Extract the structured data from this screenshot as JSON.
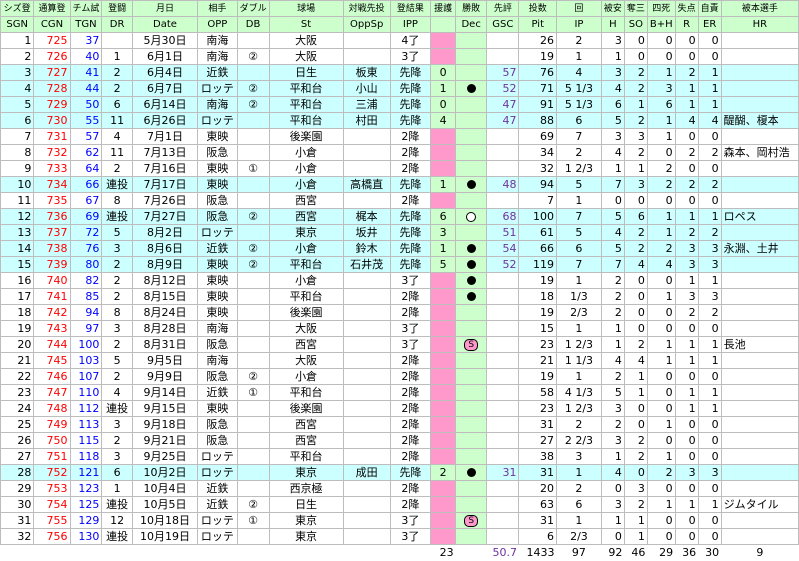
{
  "headers_jp": [
    "シズ登",
    "通算登",
    "チム試",
    "登闘",
    "月日",
    "相手",
    "ダブル",
    "球場",
    "対戦先投",
    "登結果",
    "援護",
    "勝敗",
    "先評",
    "投数",
    "回",
    "被安",
    "奪三",
    "四死",
    "失点",
    "自責",
    "被本選手"
  ],
  "headers_en": [
    "SGN",
    "CGN",
    "TGN",
    "DR",
    "Date",
    "OPP",
    "DB",
    "St",
    "OppSp",
    "IPP",
    "",
    "Dec",
    "GSC",
    "Pit",
    "IP",
    "H",
    "SO",
    "B+H",
    "R",
    "ER",
    "HR"
  ],
  "rows": [
    {
      "sgn": "1",
      "cgn": "725",
      "tgn": "37",
      "dr": "",
      "date": "5月30日",
      "opp": "南海",
      "db": "",
      "st": "大阪",
      "oppsp": "",
      "ipp": "4了",
      "sup": "",
      "dec": "",
      "gsc": "",
      "pit": "26",
      "ip": "2",
      "h": "3",
      "so": "0",
      "bh": "0",
      "r": "0",
      "er": "0",
      "hr": ""
    },
    {
      "sgn": "2",
      "cgn": "726",
      "tgn": "40",
      "dr": "1",
      "date": "6月1日",
      "opp": "南海",
      "db": "②",
      "st": "大阪",
      "oppsp": "",
      "ipp": "3了",
      "sup": "",
      "dec": "",
      "gsc": "",
      "pit": "19",
      "ip": "1",
      "h": "1",
      "so": "0",
      "bh": "0",
      "r": "0",
      "er": "0",
      "hr": ""
    },
    {
      "sgn": "3",
      "cgn": "727",
      "tgn": "41",
      "dr": "2",
      "date": "6月4日",
      "opp": "近鉄",
      "db": "",
      "st": "日生",
      "oppsp": "板東",
      "ipp": "先降",
      "sup": "0",
      "dec": "",
      "gsc": "57",
      "pit": "76",
      "ip": "4",
      "h": "3",
      "so": "2",
      "bh": "1",
      "r": "2",
      "er": "1",
      "hr": ""
    },
    {
      "sgn": "4",
      "cgn": "728",
      "tgn": "44",
      "dr": "2",
      "date": "6月7日",
      "opp": "ロッテ",
      "db": "②",
      "st": "平和台",
      "oppsp": "小山",
      "ipp": "先降",
      "sup": "1",
      "dec": "dot",
      "gsc": "52",
      "pit": "71",
      "ip": "5 1/3",
      "h": "4",
      "so": "2",
      "bh": "3",
      "r": "1",
      "er": "1",
      "hr": ""
    },
    {
      "sgn": "5",
      "cgn": "729",
      "tgn": "50",
      "dr": "6",
      "date": "6月14日",
      "opp": "南海",
      "db": "②",
      "st": "平和台",
      "oppsp": "三浦",
      "ipp": "先降",
      "sup": "0",
      "dec": "",
      "gsc": "47",
      "pit": "91",
      "ip": "5 1/3",
      "h": "6",
      "so": "1",
      "bh": "6",
      "r": "1",
      "er": "1",
      "hr": ""
    },
    {
      "sgn": "6",
      "cgn": "730",
      "tgn": "55",
      "dr": "11",
      "date": "6月26日",
      "opp": "ロッテ",
      "db": "",
      "st": "平和台",
      "oppsp": "村田",
      "ipp": "先降",
      "sup": "4",
      "dec": "",
      "gsc": "47",
      "pit": "88",
      "ip": "6",
      "h": "5",
      "so": "2",
      "bh": "1",
      "r": "4",
      "er": "4",
      "hr": "醍醐、榎本"
    },
    {
      "sgn": "7",
      "cgn": "731",
      "tgn": "57",
      "dr": "4",
      "date": "7月1日",
      "opp": "東映",
      "db": "",
      "st": "後楽園",
      "oppsp": "",
      "ipp": "2降",
      "sup": "",
      "dec": "",
      "gsc": "",
      "pit": "69",
      "ip": "7",
      "h": "3",
      "so": "3",
      "bh": "1",
      "r": "0",
      "er": "0",
      "hr": ""
    },
    {
      "sgn": "8",
      "cgn": "732",
      "tgn": "62",
      "dr": "11",
      "date": "7月13日",
      "opp": "阪急",
      "db": "",
      "st": "小倉",
      "oppsp": "",
      "ipp": "2降",
      "sup": "",
      "dec": "",
      "gsc": "",
      "pit": "34",
      "ip": "2",
      "h": "4",
      "so": "2",
      "bh": "0",
      "r": "2",
      "er": "2",
      "hr": "森本、岡村浩"
    },
    {
      "sgn": "9",
      "cgn": "733",
      "tgn": "64",
      "dr": "2",
      "date": "7月16日",
      "opp": "東映",
      "db": "①",
      "st": "小倉",
      "oppsp": "",
      "ipp": "2降",
      "sup": "",
      "dec": "",
      "gsc": "",
      "pit": "32",
      "ip": "1 2/3",
      "h": "1",
      "so": "1",
      "bh": "2",
      "r": "0",
      "er": "0",
      "hr": ""
    },
    {
      "sgn": "10",
      "cgn": "734",
      "tgn": "66",
      "dr": "連投",
      "date": "7月17日",
      "opp": "東映",
      "db": "",
      "st": "小倉",
      "oppsp": "高橋直",
      "ipp": "先降",
      "sup": "1",
      "dec": "dot",
      "gsc": "48",
      "pit": "94",
      "ip": "5",
      "h": "7",
      "so": "3",
      "bh": "2",
      "r": "2",
      "er": "2",
      "hr": ""
    },
    {
      "sgn": "11",
      "cgn": "735",
      "tgn": "67",
      "dr": "8",
      "date": "7月26日",
      "opp": "阪急",
      "db": "",
      "st": "西宮",
      "oppsp": "",
      "ipp": "2降",
      "sup": "",
      "dec": "",
      "gsc": "",
      "pit": "7",
      "ip": "1",
      "h": "0",
      "so": "0",
      "bh": "0",
      "r": "0",
      "er": "0",
      "hr": ""
    },
    {
      "sgn": "12",
      "cgn": "736",
      "tgn": "69",
      "dr": "連投",
      "date": "7月27日",
      "opp": "阪急",
      "db": "②",
      "st": "西宮",
      "oppsp": "梶本",
      "ipp": "先降",
      "sup": "6",
      "dec": "ring",
      "gsc": "68",
      "pit": "100",
      "ip": "7",
      "h": "5",
      "so": "6",
      "bh": "1",
      "r": "1",
      "er": "1",
      "hr": "ロペス"
    },
    {
      "sgn": "13",
      "cgn": "737",
      "tgn": "72",
      "dr": "5",
      "date": "8月2日",
      "opp": "ロッテ",
      "db": "",
      "st": "東京",
      "oppsp": "坂井",
      "ipp": "先降",
      "sup": "3",
      "dec": "",
      "gsc": "51",
      "pit": "61",
      "ip": "5",
      "h": "4",
      "so": "2",
      "bh": "1",
      "r": "2",
      "er": "2",
      "hr": ""
    },
    {
      "sgn": "14",
      "cgn": "738",
      "tgn": "76",
      "dr": "3",
      "date": "8月6日",
      "opp": "近鉄",
      "db": "②",
      "st": "小倉",
      "oppsp": "鈴木",
      "ipp": "先降",
      "sup": "1",
      "dec": "dot",
      "gsc": "54",
      "pit": "66",
      "ip": "6",
      "h": "5",
      "so": "2",
      "bh": "2",
      "r": "3",
      "er": "3",
      "hr": "永淵、土井"
    },
    {
      "sgn": "15",
      "cgn": "739",
      "tgn": "80",
      "dr": "2",
      "date": "8月9日",
      "opp": "東映",
      "db": "②",
      "st": "平和台",
      "oppsp": "石井茂",
      "ipp": "先降",
      "sup": "5",
      "dec": "dot",
      "gsc": "52",
      "pit": "119",
      "ip": "7",
      "h": "7",
      "so": "4",
      "bh": "4",
      "r": "3",
      "er": "3",
      "hr": ""
    },
    {
      "sgn": "16",
      "cgn": "740",
      "tgn": "82",
      "dr": "2",
      "date": "8月12日",
      "opp": "東映",
      "db": "",
      "st": "小倉",
      "oppsp": "",
      "ipp": "3了",
      "sup": "",
      "dec": "dot",
      "gsc": "",
      "pit": "19",
      "ip": "1",
      "h": "2",
      "so": "0",
      "bh": "0",
      "r": "1",
      "er": "1",
      "hr": ""
    },
    {
      "sgn": "17",
      "cgn": "741",
      "tgn": "85",
      "dr": "2",
      "date": "8月15日",
      "opp": "東映",
      "db": "",
      "st": "平和台",
      "oppsp": "",
      "ipp": "2降",
      "sup": "",
      "dec": "dot",
      "gsc": "",
      "pit": "18",
      "ip": "1/3",
      "h": "2",
      "so": "0",
      "bh": "1",
      "r": "3",
      "er": "3",
      "hr": ""
    },
    {
      "sgn": "18",
      "cgn": "742",
      "tgn": "94",
      "dr": "8",
      "date": "8月24日",
      "opp": "東映",
      "db": "",
      "st": "後楽園",
      "oppsp": "",
      "ipp": "2降",
      "sup": "",
      "dec": "",
      "gsc": "",
      "pit": "19",
      "ip": "2/3",
      "h": "2",
      "so": "0",
      "bh": "0",
      "r": "2",
      "er": "2",
      "hr": ""
    },
    {
      "sgn": "19",
      "cgn": "743",
      "tgn": "97",
      "dr": "3",
      "date": "8月28日",
      "opp": "南海",
      "db": "",
      "st": "大阪",
      "oppsp": "",
      "ipp": "3了",
      "sup": "",
      "dec": "",
      "gsc": "",
      "pit": "15",
      "ip": "1",
      "h": "1",
      "so": "0",
      "bh": "0",
      "r": "0",
      "er": "0",
      "hr": ""
    },
    {
      "sgn": "20",
      "cgn": "744",
      "tgn": "100",
      "dr": "2",
      "date": "8月31日",
      "opp": "阪急",
      "db": "",
      "st": "西宮",
      "oppsp": "",
      "ipp": "3了",
      "sup": "",
      "dec": "sv",
      "gsc": "",
      "pit": "23",
      "ip": "1 2/3",
      "h": "1",
      "so": "2",
      "bh": "1",
      "r": "1",
      "er": "1",
      "hr": "長池"
    },
    {
      "sgn": "21",
      "cgn": "745",
      "tgn": "103",
      "dr": "5",
      "date": "9月5日",
      "opp": "南海",
      "db": "",
      "st": "大阪",
      "oppsp": "",
      "ipp": "2降",
      "sup": "",
      "dec": "",
      "gsc": "",
      "pit": "21",
      "ip": "1 1/3",
      "h": "4",
      "so": "4",
      "bh": "1",
      "r": "1",
      "er": "1",
      "hr": ""
    },
    {
      "sgn": "22",
      "cgn": "746",
      "tgn": "107",
      "dr": "2",
      "date": "9月9日",
      "opp": "阪急",
      "db": "②",
      "st": "小倉",
      "oppsp": "",
      "ipp": "2降",
      "sup": "",
      "dec": "",
      "gsc": "",
      "pit": "19",
      "ip": "1",
      "h": "2",
      "so": "1",
      "bh": "0",
      "r": "0",
      "er": "0",
      "hr": ""
    },
    {
      "sgn": "23",
      "cgn": "747",
      "tgn": "110",
      "dr": "4",
      "date": "9月14日",
      "opp": "近鉄",
      "db": "①",
      "st": "平和台",
      "oppsp": "",
      "ipp": "2降",
      "sup": "",
      "dec": "",
      "gsc": "",
      "pit": "58",
      "ip": "4 1/3",
      "h": "5",
      "so": "1",
      "bh": "0",
      "r": "1",
      "er": "1",
      "hr": ""
    },
    {
      "sgn": "24",
      "cgn": "748",
      "tgn": "112",
      "dr": "連投",
      "date": "9月15日",
      "opp": "東映",
      "db": "",
      "st": "後楽園",
      "oppsp": "",
      "ipp": "2降",
      "sup": "",
      "dec": "",
      "gsc": "",
      "pit": "23",
      "ip": "1 2/3",
      "h": "3",
      "so": "0",
      "bh": "0",
      "r": "1",
      "er": "1",
      "hr": ""
    },
    {
      "sgn": "25",
      "cgn": "749",
      "tgn": "113",
      "dr": "3",
      "date": "9月18日",
      "opp": "阪急",
      "db": "",
      "st": "西宮",
      "oppsp": "",
      "ipp": "2降",
      "sup": "",
      "dec": "",
      "gsc": "",
      "pit": "31",
      "ip": "2",
      "h": "2",
      "so": "0",
      "bh": "1",
      "r": "0",
      "er": "0",
      "hr": ""
    },
    {
      "sgn": "26",
      "cgn": "750",
      "tgn": "115",
      "dr": "2",
      "date": "9月21日",
      "opp": "阪急",
      "db": "",
      "st": "西宮",
      "oppsp": "",
      "ipp": "2降",
      "sup": "",
      "dec": "",
      "gsc": "",
      "pit": "27",
      "ip": "2 2/3",
      "h": "3",
      "so": "2",
      "bh": "0",
      "r": "0",
      "er": "0",
      "hr": ""
    },
    {
      "sgn": "27",
      "cgn": "751",
      "tgn": "118",
      "dr": "3",
      "date": "9月25日",
      "opp": "ロッテ",
      "db": "",
      "st": "平和台",
      "oppsp": "",
      "ipp": "2降",
      "sup": "",
      "dec": "",
      "gsc": "",
      "pit": "38",
      "ip": "3",
      "h": "1",
      "so": "2",
      "bh": "1",
      "r": "0",
      "er": "0",
      "hr": ""
    },
    {
      "sgn": "28",
      "cgn": "752",
      "tgn": "121",
      "dr": "6",
      "date": "10月2日",
      "opp": "ロッテ",
      "db": "",
      "st": "東京",
      "oppsp": "成田",
      "ipp": "先降",
      "sup": "2",
      "dec": "dot",
      "gsc": "31",
      "pit": "31",
      "ip": "1",
      "h": "4",
      "so": "0",
      "bh": "2",
      "r": "3",
      "er": "3",
      "hr": ""
    },
    {
      "sgn": "29",
      "cgn": "753",
      "tgn": "123",
      "dr": "1",
      "date": "10月4日",
      "opp": "近鉄",
      "db": "",
      "st": "西京極",
      "oppsp": "",
      "ipp": "2降",
      "sup": "",
      "dec": "",
      "gsc": "",
      "pit": "20",
      "ip": "2",
      "h": "0",
      "so": "3",
      "bh": "0",
      "r": "0",
      "er": "0",
      "hr": ""
    },
    {
      "sgn": "30",
      "cgn": "754",
      "tgn": "125",
      "dr": "連投",
      "date": "10月5日",
      "opp": "近鉄",
      "db": "②",
      "st": "日生",
      "oppsp": "",
      "ipp": "2降",
      "sup": "",
      "dec": "",
      "gsc": "",
      "pit": "63",
      "ip": "6",
      "h": "3",
      "so": "2",
      "bh": "1",
      "r": "1",
      "er": "1",
      "hr": "ジムタイル"
    },
    {
      "sgn": "31",
      "cgn": "755",
      "tgn": "129",
      "dr": "12",
      "date": "10月18日",
      "opp": "ロッテ",
      "db": "①",
      "st": "東京",
      "oppsp": "",
      "ipp": "3了",
      "sup": "",
      "dec": "sv",
      "gsc": "",
      "pit": "31",
      "ip": "1",
      "h": "1",
      "so": "1",
      "bh": "0",
      "r": "0",
      "er": "0",
      "hr": ""
    },
    {
      "sgn": "32",
      "cgn": "756",
      "tgn": "130",
      "dr": "連投",
      "date": "10月19日",
      "opp": "ロッテ",
      "db": "",
      "st": "東京",
      "oppsp": "",
      "ipp": "3了",
      "sup": "",
      "dec": "",
      "gsc": "",
      "pit": "6",
      "ip": "2/3",
      "h": "0",
      "so": "1",
      "bh": "0",
      "r": "0",
      "er": "0",
      "hr": ""
    }
  ],
  "totals": {
    "sup": "23",
    "gsc": "50.7",
    "pit": "1433",
    "ip": "97",
    "h": "92",
    "so": "46",
    "bh": "29",
    "r": "36",
    "er": "30",
    "hr": "9"
  },
  "colors": {
    "header_bg": "#ccffcc",
    "band_bg": "#ccffff",
    "cgn_red": "#ff0000",
    "tgn_blue": "#0000ff",
    "gsc_purple": "#7030a0",
    "win_pink": "#ff99cc",
    "lavender": "#cc99ff",
    "gsc_high_yellow": "#ffff00",
    "gsc_top_magenta": "#ff00ff"
  }
}
